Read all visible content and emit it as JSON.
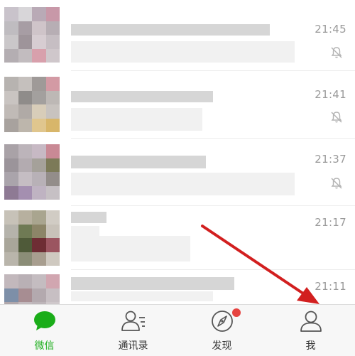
{
  "chats": [
    {
      "time": "21:45",
      "muted": true
    },
    {
      "time": "21:41",
      "muted": true
    },
    {
      "time": "21:37",
      "muted": true
    },
    {
      "time": "21:17",
      "muted": false
    },
    {
      "time": "21:11",
      "muted": false
    }
  ],
  "tabs": [
    {
      "label": "微信",
      "icon": "chat-bubble-icon",
      "active": true
    },
    {
      "label": "通讯录",
      "icon": "contacts-icon",
      "active": false
    },
    {
      "label": "发现",
      "icon": "compass-icon",
      "active": false,
      "badge": true
    },
    {
      "label": "我",
      "icon": "person-icon",
      "active": false
    }
  ],
  "colors": {
    "accent": "#1aad19",
    "badge": "#e64340",
    "arrow": "#d21f1f",
    "time_text": "#9a9a9a"
  }
}
